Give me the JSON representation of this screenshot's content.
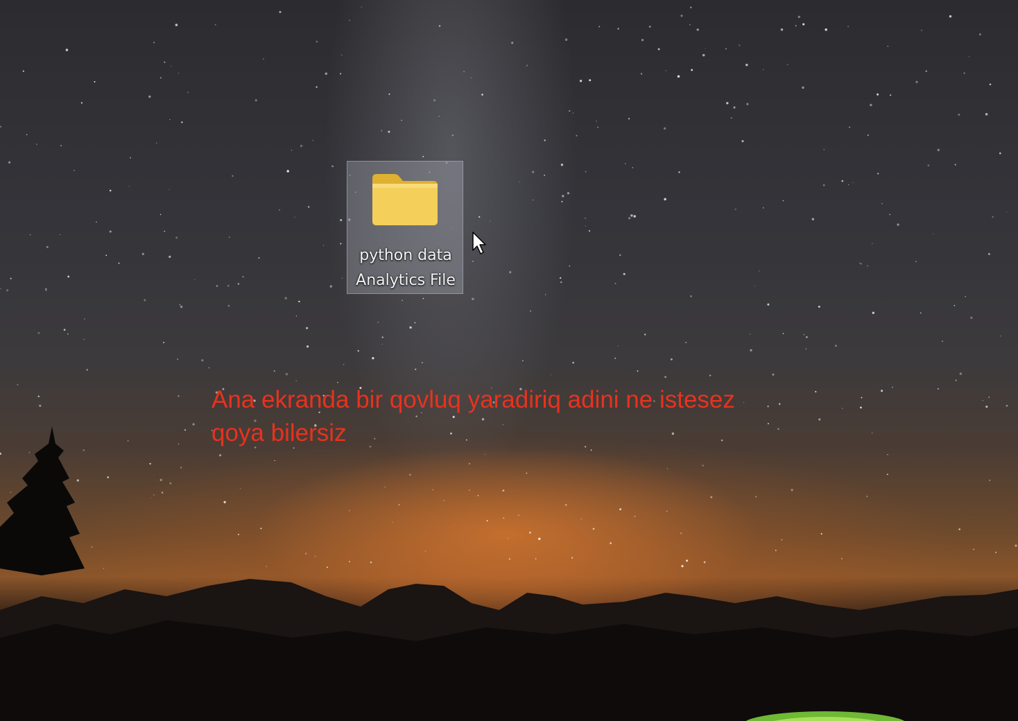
{
  "desktop": {
    "wallpaper": "night-sky-milky-way-mountains",
    "icons": [
      {
        "type": "folder",
        "icon": "folder-icon",
        "label_line1": "python data",
        "label_line2": "Analytics File",
        "selected": true
      }
    ]
  },
  "annotation": {
    "line1": "Ana ekranda bir qovluq yaradiriq adini ne istesez",
    "line2": "qoya bilersiz",
    "color": "#e8321e"
  },
  "cursor": {
    "icon": "mouse-pointer-icon"
  },
  "colors": {
    "folder_body": "#f2c94c",
    "folder_tab": "#e0b030",
    "selection": "#c8cdd7"
  }
}
